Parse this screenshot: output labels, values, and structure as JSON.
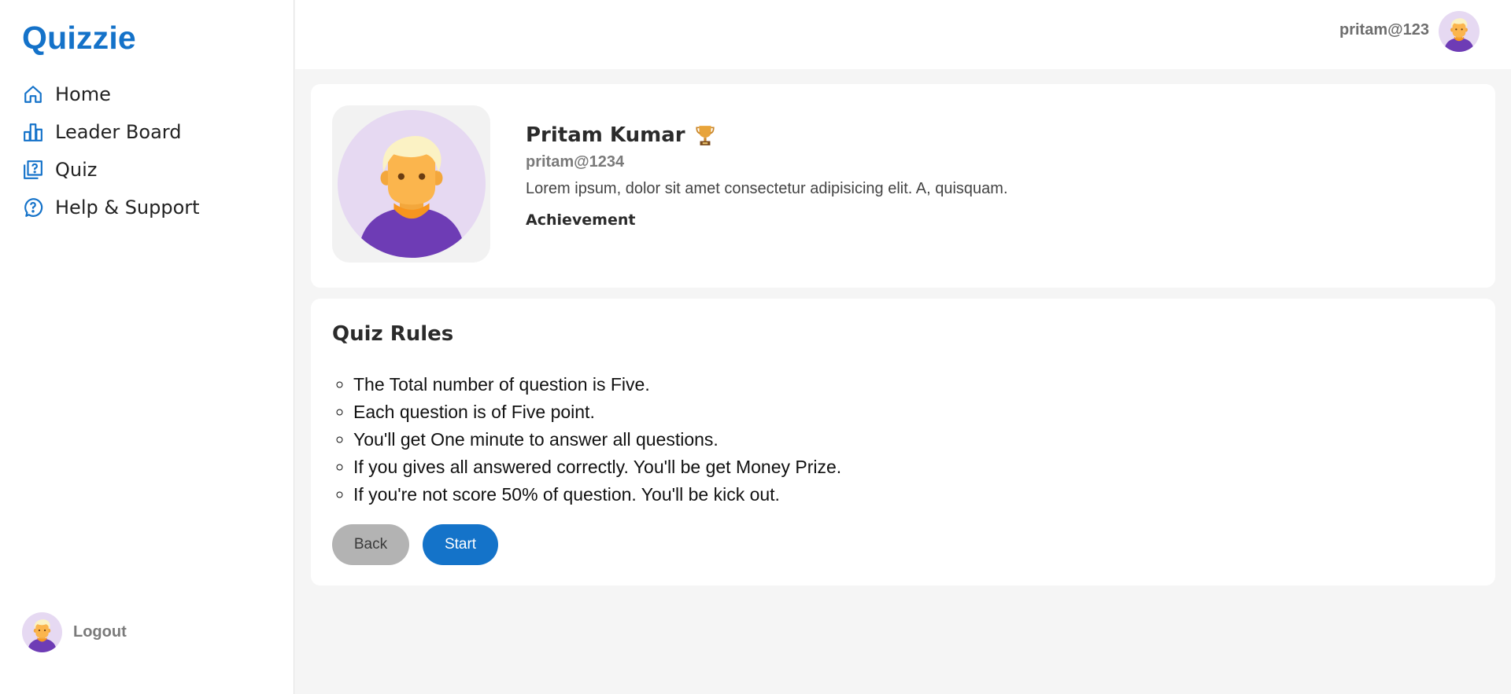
{
  "app": {
    "name": "Quizzie"
  },
  "sidebar": {
    "items": [
      {
        "label": "Home",
        "icon": "home-icon"
      },
      {
        "label": "Leader Board",
        "icon": "leaderboard-icon"
      },
      {
        "label": "Quiz",
        "icon": "quiz-icon"
      },
      {
        "label": "Help & Support",
        "icon": "help-icon"
      }
    ],
    "logout_label": "Logout"
  },
  "header": {
    "username": "pritam@123"
  },
  "profile": {
    "name": "Pritam Kumar",
    "username": "pritam@1234",
    "bio": "Lorem ipsum, dolor sit amet consectetur adipisicing elit. A, quisquam.",
    "achievement_heading": "Achievement"
  },
  "rules": {
    "title": "Quiz Rules",
    "items": [
      "The Total number of question is Five.",
      "Each question is of Five point.",
      "You'll get One minute to answer all questions.",
      "If you gives all answered correctly. You'll be get Money Prize.",
      "If you're not score 50% of question. You'll be kick out."
    ],
    "back_label": "Back",
    "start_label": "Start"
  },
  "colors": {
    "brand": "#1472c9",
    "background": "#f5f5f5",
    "back_button": "#b3b3b3",
    "start_button": "#1473c9",
    "avatar_bg": "#e6d9f2"
  }
}
